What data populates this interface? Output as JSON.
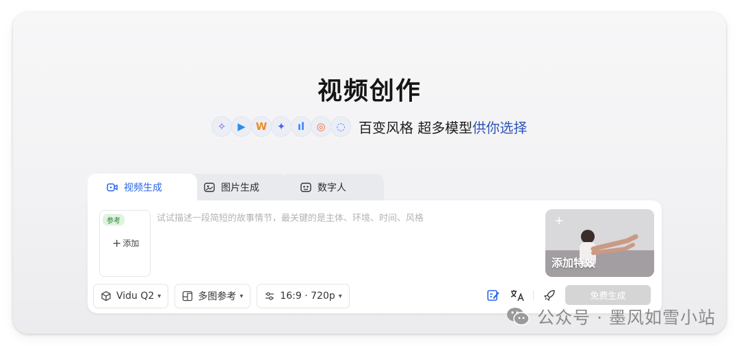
{
  "title": "视频创作",
  "tagline": {
    "part1": "百变风格 超多模型",
    "part2": "供你选择"
  },
  "model_icons": [
    {
      "glyph": "✧",
      "color": "#7b4fd8",
      "name": "model-icon-1"
    },
    {
      "glyph": "▶",
      "color": "#2c8ef0",
      "name": "model-icon-2"
    },
    {
      "glyph": "W",
      "color": "#f08a20",
      "name": "model-icon-3"
    },
    {
      "glyph": "✦",
      "color": "#4e66e8",
      "name": "model-icon-4"
    },
    {
      "glyph": "ıl",
      "color": "#3a86ff",
      "name": "model-icon-5"
    },
    {
      "glyph": "◎",
      "color": "#f0632a",
      "name": "model-icon-6"
    },
    {
      "glyph": "◌",
      "color": "#3a7cf0",
      "name": "model-icon-7"
    }
  ],
  "tabs": [
    {
      "label": "视频生成",
      "icon": "video-icon"
    },
    {
      "label": "图片生成",
      "icon": "image-icon"
    },
    {
      "label": "数字人",
      "icon": "avatar-icon"
    }
  ],
  "reference": {
    "badge": "参考",
    "add_label": "添加"
  },
  "prompt": {
    "placeholder": "试试描述一段简短的故事情节，最关键的是主体、环境、时间、风格"
  },
  "effect": {
    "label": "添加特效"
  },
  "controls": {
    "model": "Vidu Q2",
    "reference_mode": "多图参考",
    "ratio_quality": "16:9 · 720p"
  },
  "generate_button": "免费生成",
  "watermark": "公众号 · 墨风如雪小站",
  "colors": {
    "accent": "#2563eb",
    "tagline_blue": "#2f55b8",
    "disabled_button": "#d5d5d5"
  }
}
